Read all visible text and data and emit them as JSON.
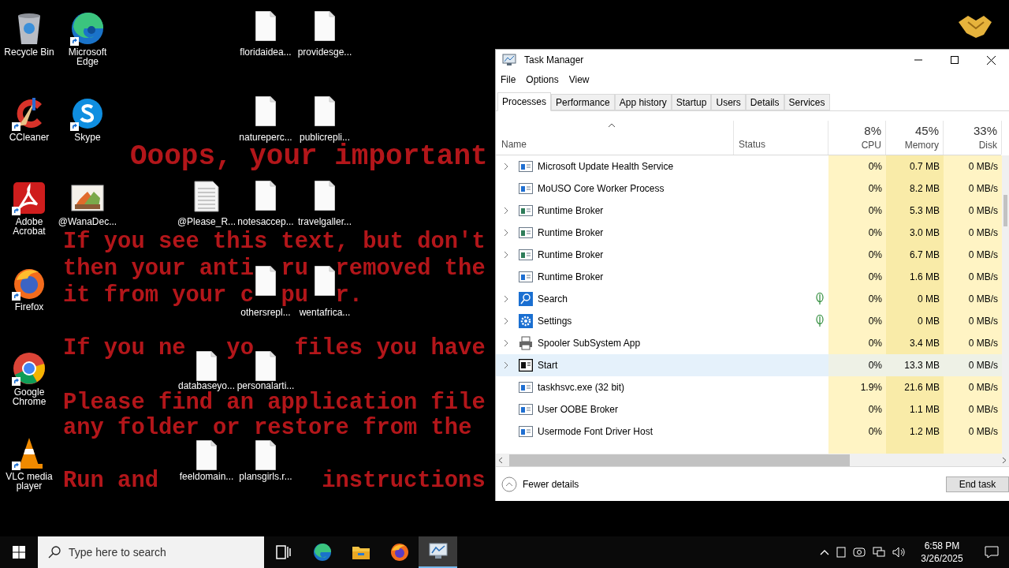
{
  "desktop": {
    "wallpaper_text": [
      [
        "Ooops, your important"
      ],
      [
        "If you see this text, but don't"
      ],
      [
        "then your anti",
        "ru",
        "removed the"
      ],
      [
        "it from your c",
        "pu",
        "r."
      ],
      [
        "If you ne",
        "yo",
        "files you have"
      ],
      [
        "Please find an application file"
      ],
      [
        "any folder or restore from the"
      ],
      [
        "Run and",
        "instructions"
      ]
    ],
    "icons": [
      {
        "label": "Recycle Bin",
        "kind": "recycle",
        "shortcut": false
      },
      {
        "label": "Microsoft Edge",
        "kind": "edge",
        "shortcut": true
      },
      {
        "label": "floridaidea...",
        "kind": "file",
        "shortcut": false
      },
      {
        "label": "providesge...",
        "kind": "file",
        "shortcut": false
      },
      {
        "label": "CCleaner",
        "kind": "ccleaner",
        "shortcut": true
      },
      {
        "label": "Skype",
        "kind": "skype",
        "shortcut": true
      },
      {
        "label": "natureperc...",
        "kind": "file",
        "shortcut": false
      },
      {
        "label": "publicrepli...",
        "kind": "file",
        "shortcut": false
      },
      {
        "label": "Adobe Acrobat",
        "kind": "acrobat",
        "shortcut": true
      },
      {
        "label": "@WanaDec...",
        "kind": "image",
        "shortcut": false
      },
      {
        "label": "@Please_R...",
        "kind": "textfile",
        "shortcut": false
      },
      {
        "label": "notesaccep...",
        "kind": "file",
        "shortcut": false
      },
      {
        "label": "travelgaller...",
        "kind": "file",
        "shortcut": false
      },
      {
        "label": "Firefox",
        "kind": "firefox",
        "shortcut": true
      },
      {
        "label": "othersrepl...",
        "kind": "file",
        "shortcut": false
      },
      {
        "label": "wentafrica...",
        "kind": "file",
        "shortcut": false
      },
      {
        "label": "Google Chrome",
        "kind": "chrome",
        "shortcut": true
      },
      {
        "label": "databaseyo...",
        "kind": "file",
        "shortcut": false
      },
      {
        "label": "personalarti...",
        "kind": "file",
        "shortcut": false
      },
      {
        "label": "VLC media player",
        "kind": "vlc",
        "shortcut": true
      },
      {
        "label": "feeldomain...",
        "kind": "file",
        "shortcut": false
      },
      {
        "label": "plansgirls.r...",
        "kind": "file",
        "shortcut": false
      }
    ]
  },
  "task_manager": {
    "title": "Task Manager",
    "menu": [
      "File",
      "Options",
      "View"
    ],
    "tabs": [
      {
        "label": "Processes",
        "selected": true
      },
      {
        "label": "Performance",
        "selected": false
      },
      {
        "label": "App history",
        "selected": false
      },
      {
        "label": "Startup",
        "selected": false
      },
      {
        "label": "Users",
        "selected": false
      },
      {
        "label": "Details",
        "selected": false
      },
      {
        "label": "Services",
        "selected": false
      }
    ],
    "columns": {
      "name": "Name",
      "status": "Status",
      "cpu": {
        "label": "CPU",
        "percent": "8%"
      },
      "memory": {
        "label": "Memory",
        "percent": "45%"
      },
      "disk": {
        "label": "Disk",
        "percent": "33%"
      }
    },
    "rows": [
      {
        "name": "Microsoft Update Health Service",
        "kind": "service",
        "expandable": true,
        "eco": false,
        "selected": false,
        "cpu": "0%",
        "memory": "0.7 MB",
        "disk": "0 MB/s"
      },
      {
        "name": "MoUSO Core Worker Process",
        "kind": "service",
        "expandable": false,
        "eco": false,
        "selected": false,
        "cpu": "0%",
        "memory": "8.2 MB",
        "disk": "0 MB/s"
      },
      {
        "name": "Runtime Broker",
        "kind": "broker",
        "expandable": true,
        "eco": false,
        "selected": false,
        "cpu": "0%",
        "memory": "5.3 MB",
        "disk": "0 MB/s"
      },
      {
        "name": "Runtime Broker",
        "kind": "broker",
        "expandable": true,
        "eco": false,
        "selected": false,
        "cpu": "0%",
        "memory": "3.0 MB",
        "disk": "0 MB/s"
      },
      {
        "name": "Runtime Broker",
        "kind": "broker",
        "expandable": true,
        "eco": false,
        "selected": false,
        "cpu": "0%",
        "memory": "6.7 MB",
        "disk": "0 MB/s"
      },
      {
        "name": "Runtime Broker",
        "kind": "service",
        "expandable": false,
        "eco": false,
        "selected": false,
        "cpu": "0%",
        "memory": "1.6 MB",
        "disk": "0 MB/s"
      },
      {
        "name": "Search",
        "kind": "search",
        "expandable": true,
        "eco": true,
        "selected": false,
        "cpu": "0%",
        "memory": "0 MB",
        "disk": "0 MB/s"
      },
      {
        "name": "Settings",
        "kind": "settings",
        "expandable": true,
        "eco": true,
        "selected": false,
        "cpu": "0%",
        "memory": "0 MB",
        "disk": "0 MB/s"
      },
      {
        "name": "Spooler SubSystem App",
        "kind": "printer",
        "expandable": true,
        "eco": false,
        "selected": false,
        "cpu": "0%",
        "memory": "3.4 MB",
        "disk": "0 MB/s"
      },
      {
        "name": "Start",
        "kind": "start",
        "expandable": true,
        "eco": false,
        "selected": true,
        "cpu": "0%",
        "memory": "13.3 MB",
        "disk": "0 MB/s"
      },
      {
        "name": "taskhsvc.exe (32 bit)",
        "kind": "service",
        "expandable": false,
        "eco": false,
        "selected": false,
        "cpu": "1.9%",
        "memory": "21.6 MB",
        "disk": "0 MB/s"
      },
      {
        "name": "User OOBE Broker",
        "kind": "service",
        "expandable": false,
        "eco": false,
        "selected": false,
        "cpu": "0%",
        "memory": "1.1 MB",
        "disk": "0 MB/s"
      },
      {
        "name": "Usermode Font Driver Host",
        "kind": "service",
        "expandable": false,
        "eco": false,
        "selected": false,
        "cpu": "0%",
        "memory": "1.2 MB",
        "disk": "0 MB/s"
      }
    ],
    "fewer_details": "Fewer details",
    "end_task": "End task"
  },
  "taskbar": {
    "search_placeholder": "Type here to search",
    "apps": [
      {
        "kind": "taskview",
        "active": false
      },
      {
        "kind": "edge",
        "active": false
      },
      {
        "kind": "explorer",
        "active": false
      },
      {
        "kind": "firefox",
        "active": false
      },
      {
        "kind": "taskmanager",
        "active": true
      }
    ],
    "time": "6:58 PM",
    "date": "3/26/2025"
  }
}
